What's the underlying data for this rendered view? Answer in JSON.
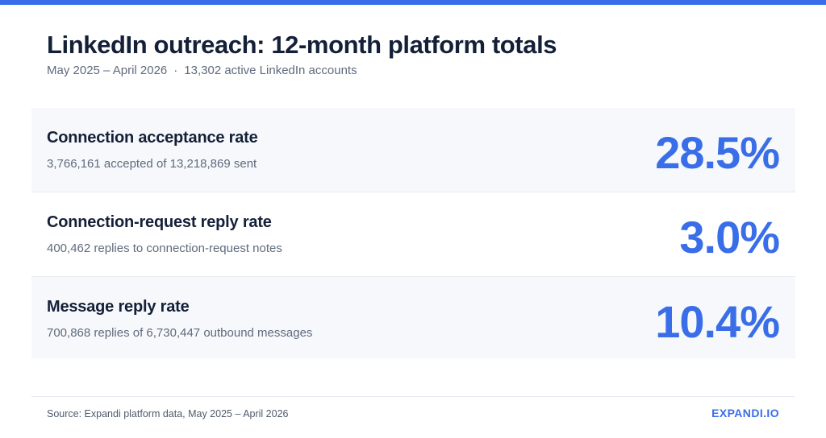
{
  "header": {
    "title": "LinkedIn outreach: 12-month platform totals",
    "period": "May 2025 – April 2026",
    "separator": "·",
    "accounts": "13,302 active LinkedIn accounts"
  },
  "metrics": [
    {
      "label": "Connection acceptance rate",
      "detail": "3,766,161 accepted of 13,218,869 sent",
      "value": "28.5%"
    },
    {
      "label": "Connection-request reply rate",
      "detail": "400,462 replies to connection-request notes",
      "value": "3.0%"
    },
    {
      "label": "Message reply rate",
      "detail": "700,868 replies of 6,730,447 outbound messages",
      "value": "10.4%"
    }
  ],
  "footer": {
    "source": "Source: Expandi platform data, May 2025 – April 2026",
    "brand": "EXPANDI.IO"
  },
  "colors": {
    "accent": "#3a6ee8",
    "heading": "#142038",
    "muted_text": "#5f6b7d",
    "row_shade": "#f6f8fc",
    "divider": "#e6e9ef"
  }
}
